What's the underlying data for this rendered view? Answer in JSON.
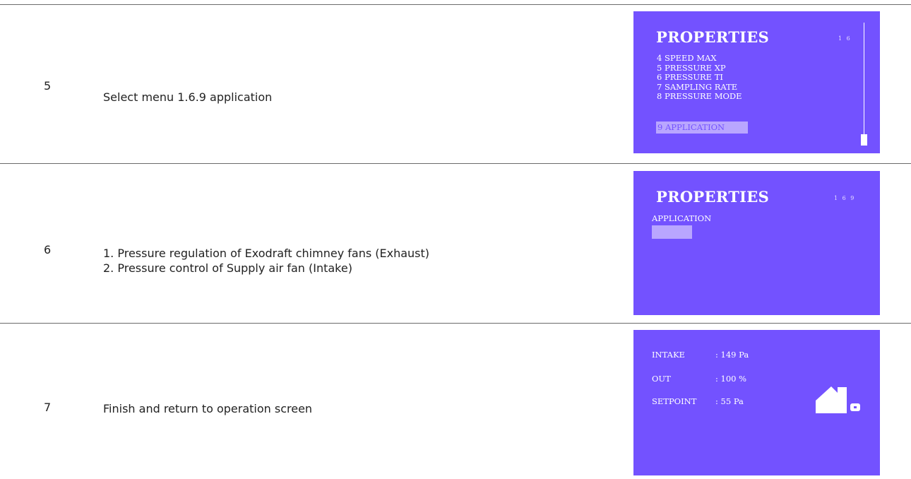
{
  "steps": [
    {
      "number": "5",
      "lines": [
        "Select menu 1.6.9 application"
      ],
      "screen": {
        "title": "PROPERTIES",
        "code": "1 6",
        "menu_items": [
          "4 SPEED MAX",
          "5 PRESSURE XP",
          "6 PRESSURE TI",
          "7 SAMPLING RATE",
          "8 PRESSURE MODE"
        ],
        "selected_item": "9 APPLICATION"
      }
    },
    {
      "number": "6",
      "lines": [
        "1. Pressure regulation of Exodraft chimney fans (Exhaust)",
        "2. Pressure control of Supply air fan (Intake)"
      ],
      "screen": {
        "title": "PROPERTIES",
        "code": "1 6 9",
        "field_label": "APPLICATION",
        "field_value": ""
      }
    },
    {
      "number": "7",
      "lines": [
        "Finish and return to operation screen"
      ],
      "screen": {
        "rows": [
          {
            "label": "INTAKE",
            "value": ": 149 Pa"
          },
          {
            "label": "OUT",
            "value": ": 100 %"
          },
          {
            "label": "SETPOINT",
            "value": ": 55 Pa"
          }
        ],
        "icon": "house-with-fan-icon"
      }
    }
  ],
  "colors": {
    "screen_bg": "#7352ff",
    "highlight": "#b9a6ff",
    "rule": "#6b6b6b"
  }
}
